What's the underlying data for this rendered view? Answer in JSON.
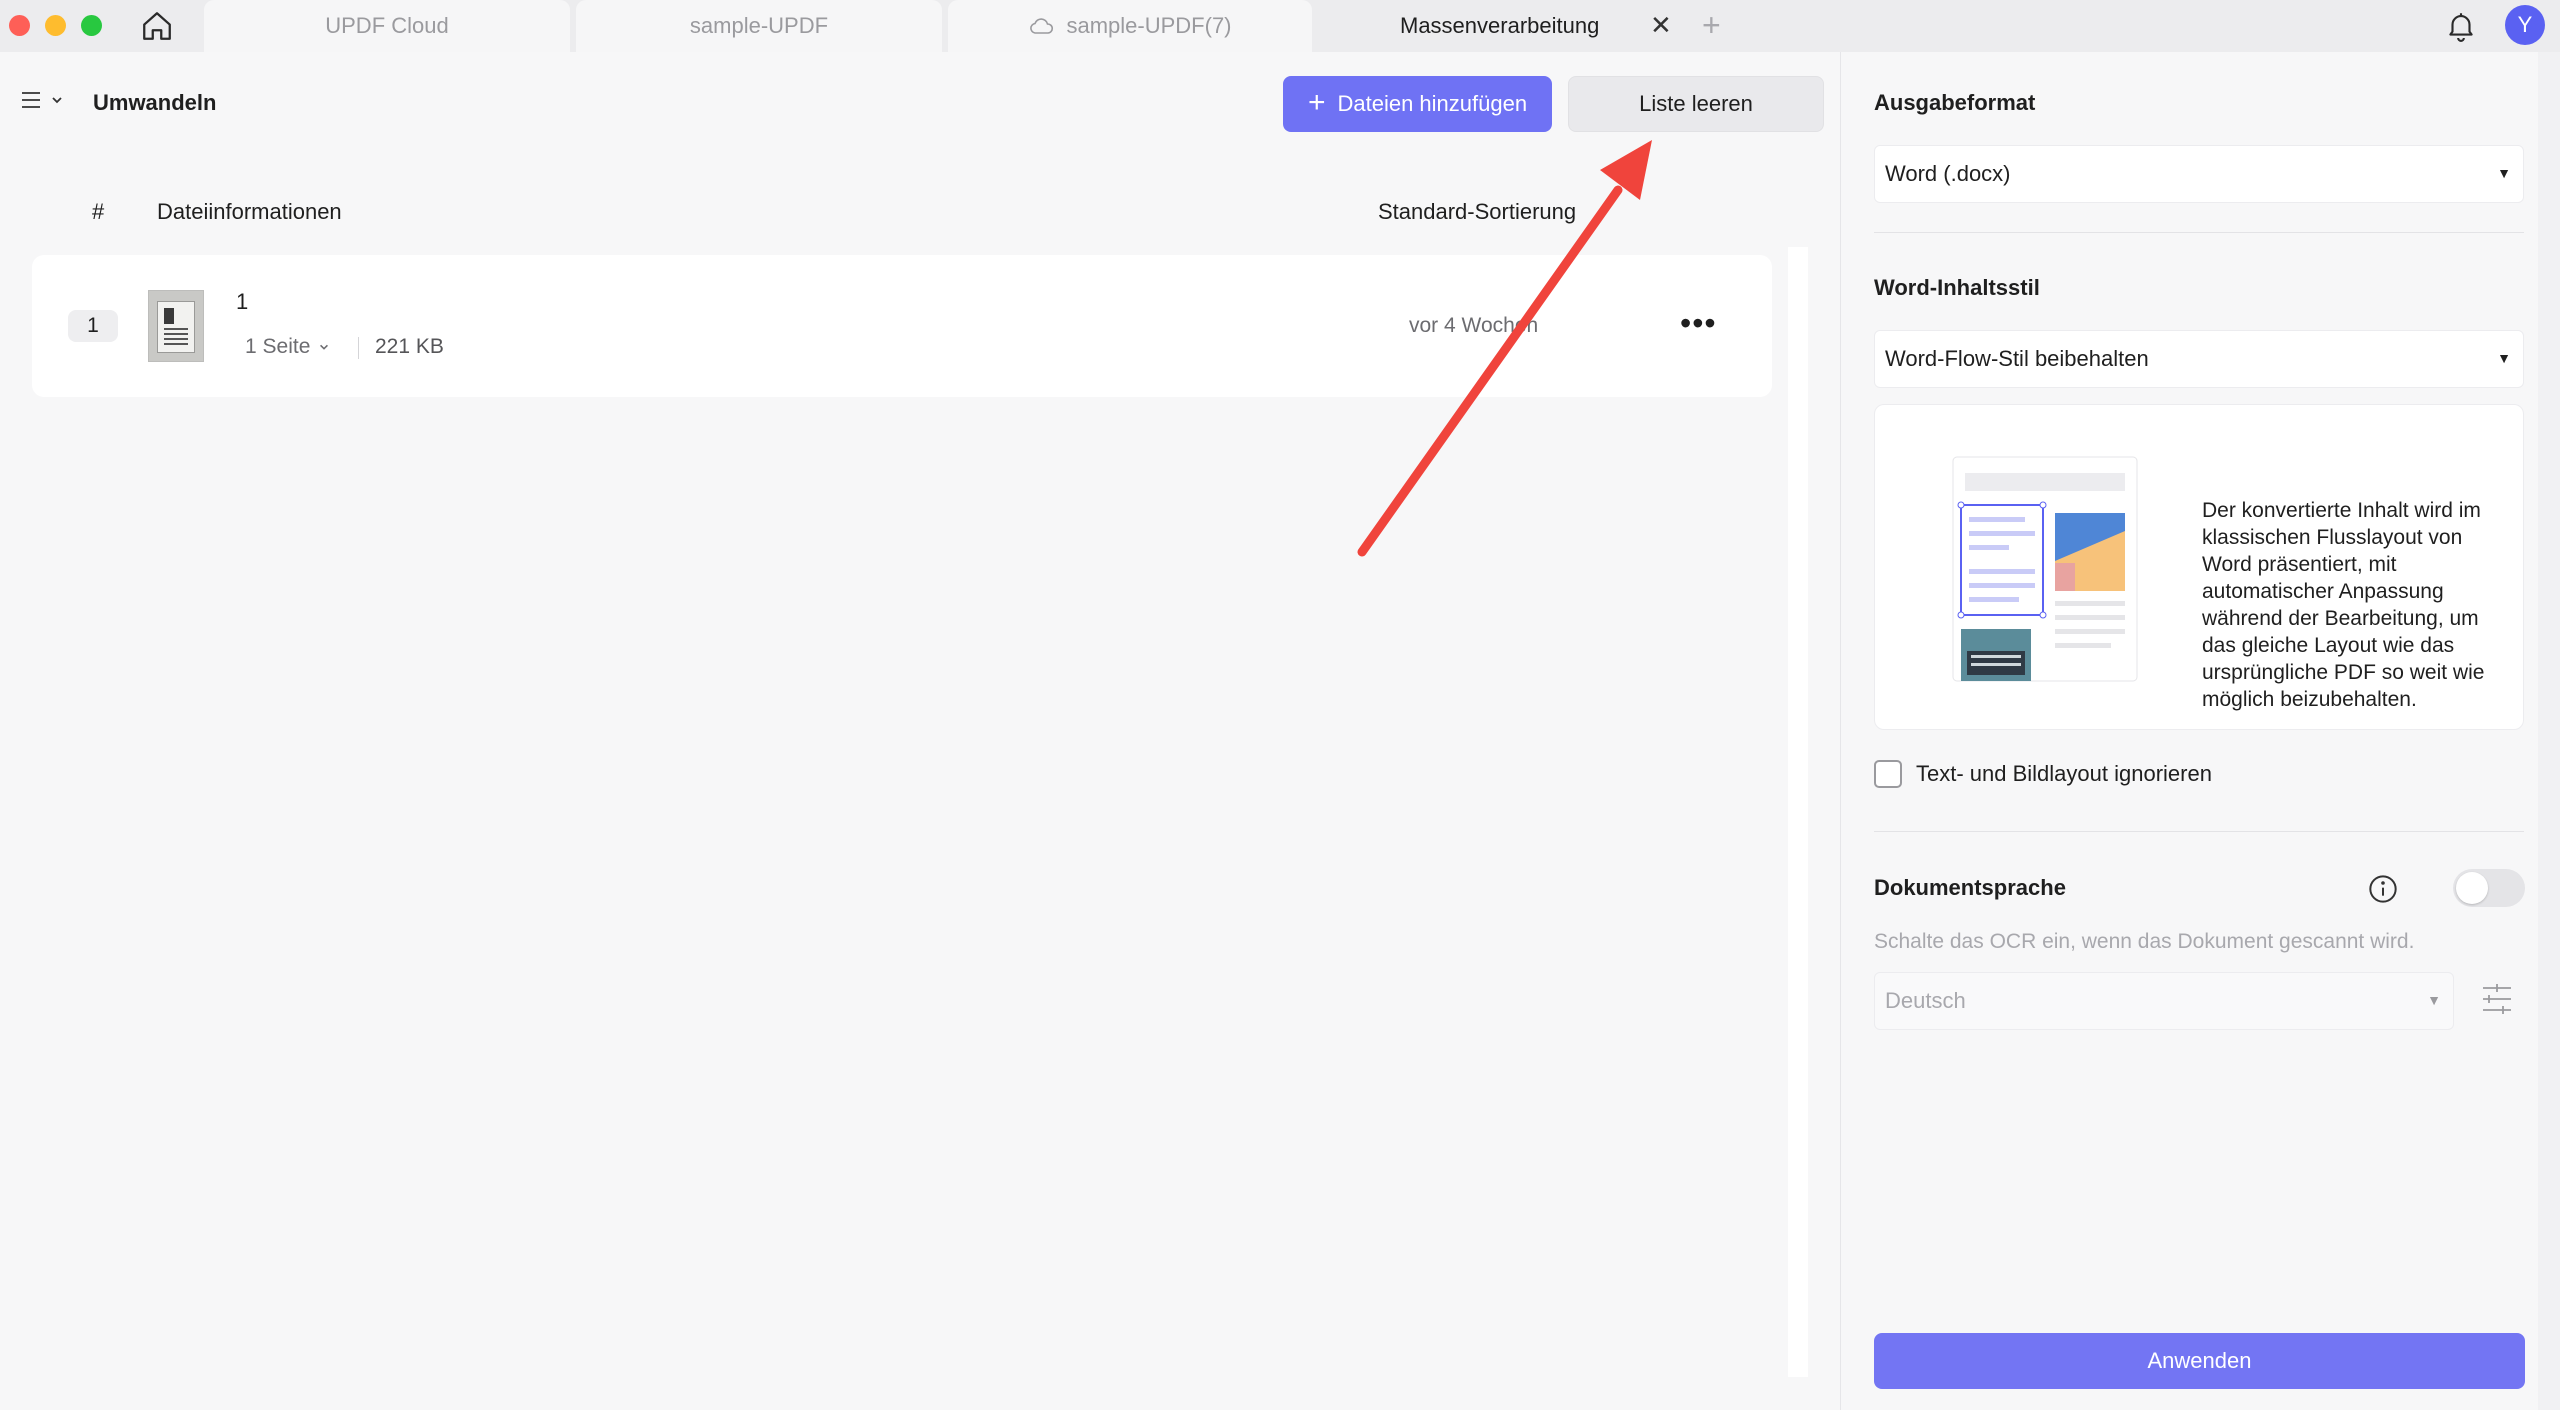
{
  "tabs": {
    "cloud": "UPDF Cloud",
    "sample": "sample-UPDF",
    "sample_cloud": "sample-UPDF(7)",
    "active": "Massenverarbeitung"
  },
  "user": {
    "avatar_initial": "Y"
  },
  "toolbar": {
    "title": "Umwandeln",
    "add_files": "Dateien hinzufügen",
    "clear_list": "Liste leeren"
  },
  "table": {
    "col_index": "#",
    "col_info": "Dateiinformationen",
    "col_sort": "Standard-Sortierung",
    "rows": [
      {
        "index": "1",
        "name": "1",
        "pages": "1 Seite",
        "size": "221 KB",
        "date": "vor 4 Wochen"
      }
    ]
  },
  "settings": {
    "output_format_label": "Ausgabeformat",
    "output_format_value": "Word (.docx)",
    "content_style_label": "Word-Inhaltsstil",
    "content_style_value": "Word-Flow-Stil beibehalten",
    "content_style_description": "Der konvertierte Inhalt wird im klassischen Flusslayout von Word präsentiert, mit automatischer Anpassung während der Bearbeitung, um das gleiche Layout wie das ursprüngliche PDF so weit wie möglich beizubehalten.",
    "ignore_layout_label": "Text- und Bildlayout ignorieren",
    "ignore_layout_checked": false,
    "document_language_label": "Dokumentsprache",
    "ocr_enabled": false,
    "ocr_hint": "Schalte das OCR ein, wenn das Dokument gescannt wird.",
    "language_value": "Deutsch",
    "apply_button": "Anwenden"
  },
  "colors": {
    "accent": "#6f72f4",
    "annotation_arrow": "#f0443c"
  }
}
